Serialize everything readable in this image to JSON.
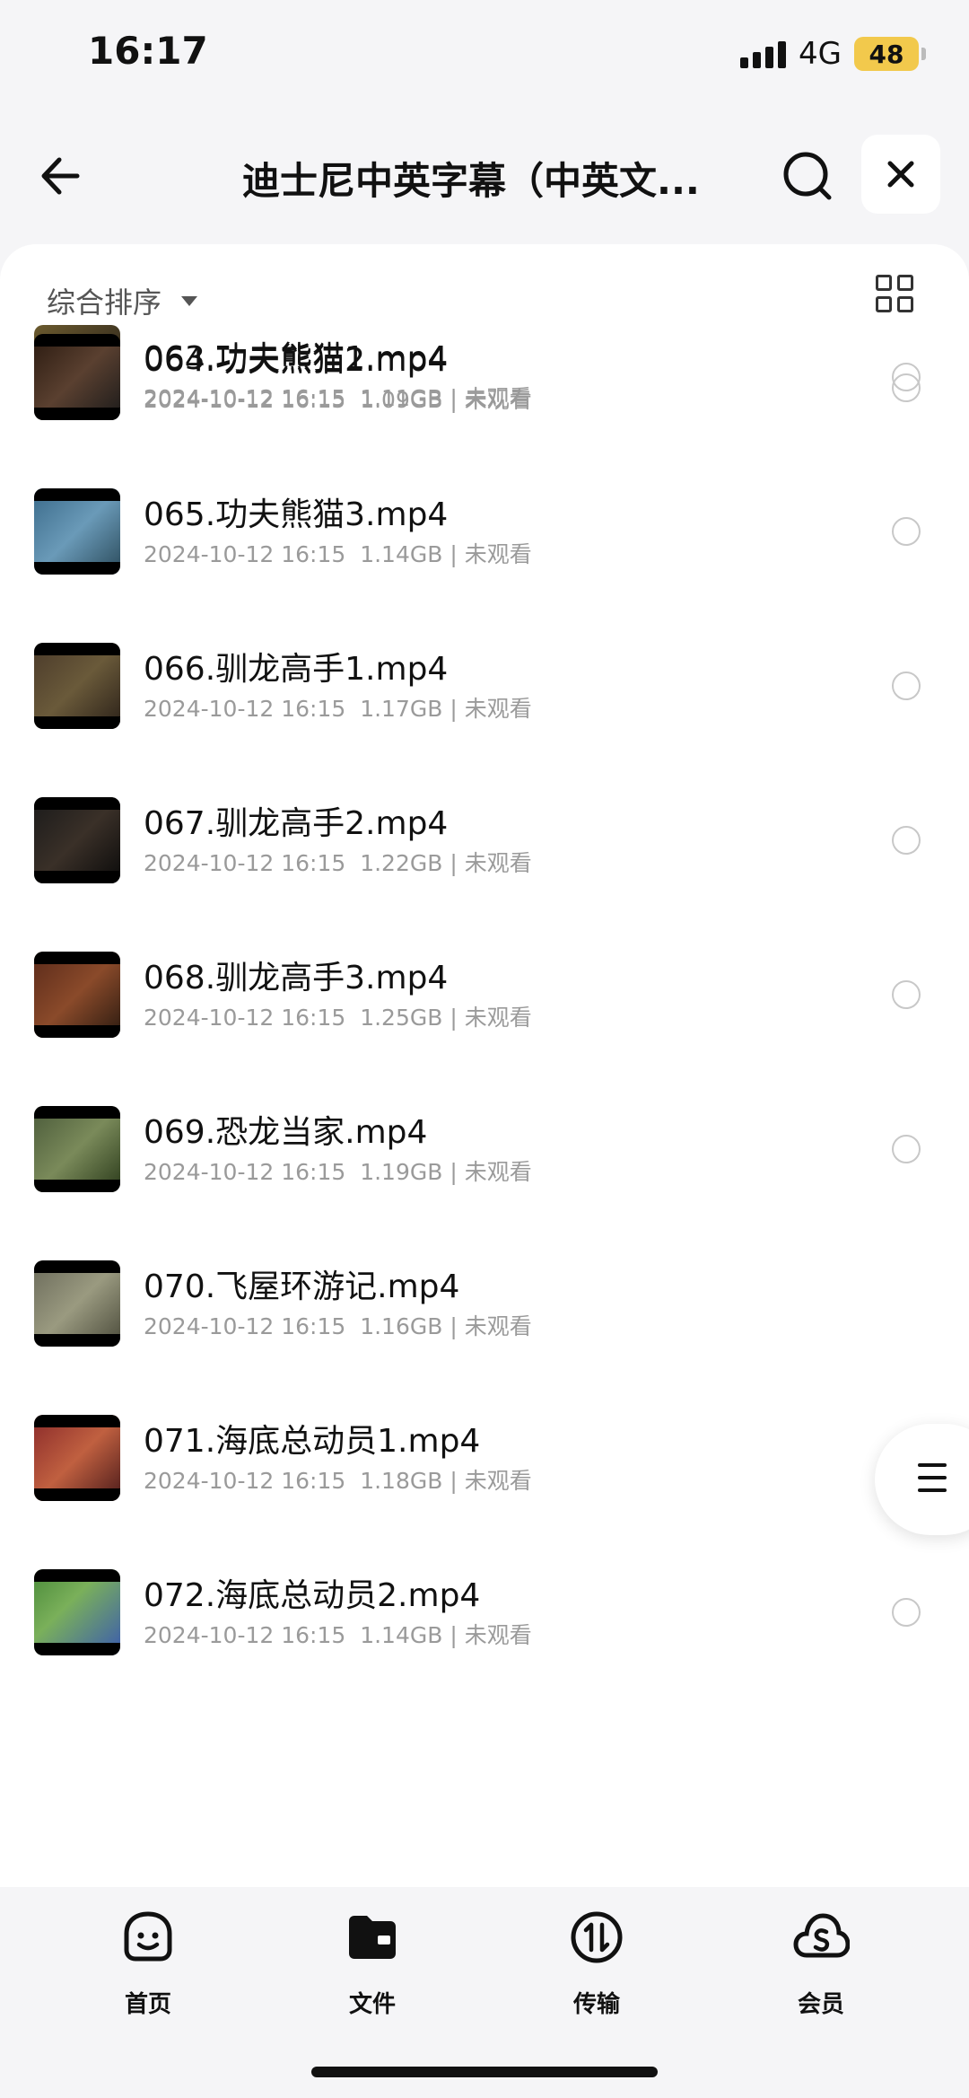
{
  "status": {
    "time": "16:17",
    "network": "4G",
    "battery": "48"
  },
  "header": {
    "title": "迪士尼中英字幕（中英文..."
  },
  "sort": {
    "label": "综合排序"
  },
  "files": [
    {
      "name": "063.功夫熊猫1.mp4",
      "date": "2024-10-12 16:15",
      "size": "1.11GB",
      "status": "未观看"
    },
    {
      "name": "064.功夫熊猫2.mp4",
      "date": "2024-10-12 16:15",
      "size": "1.09GB",
      "status": "未观看"
    },
    {
      "name": "065.功夫熊猫3.mp4",
      "date": "2024-10-12 16:15",
      "size": "1.14GB",
      "status": "未观看"
    },
    {
      "name": "066.驯龙高手1.mp4",
      "date": "2024-10-12 16:15",
      "size": "1.17GB",
      "status": "未观看"
    },
    {
      "name": "067.驯龙高手2.mp4",
      "date": "2024-10-12 16:15",
      "size": "1.22GB",
      "status": "未观看"
    },
    {
      "name": "068.驯龙高手3.mp4",
      "date": "2024-10-12 16:15",
      "size": "1.25GB",
      "status": "未观看"
    },
    {
      "name": "069.恐龙当家.mp4",
      "date": "2024-10-12 16:15",
      "size": "1.19GB",
      "status": "未观看"
    },
    {
      "name": "070.飞屋环游记.mp4",
      "date": "2024-10-12 16:15",
      "size": "1.16GB",
      "status": "未观看"
    },
    {
      "name": "071.海底总动员1.mp4",
      "date": "2024-10-12 16:15",
      "size": "1.18GB",
      "status": "未观看"
    },
    {
      "name": "072.海底总动员2.mp4",
      "date": "2024-10-12 16:15",
      "size": "1.14GB",
      "status": "未观看"
    }
  ],
  "nav": [
    {
      "label": "首页",
      "icon": "smile-face-icon"
    },
    {
      "label": "文件",
      "icon": "folder-icon"
    },
    {
      "label": "传输",
      "icon": "transfer-icon"
    },
    {
      "label": "会员",
      "icon": "cloud-icon"
    }
  ],
  "colors": {
    "accent_battery": "#f2c94c",
    "meta_text": "#9a9a9a",
    "background": "#f5f5f7"
  }
}
